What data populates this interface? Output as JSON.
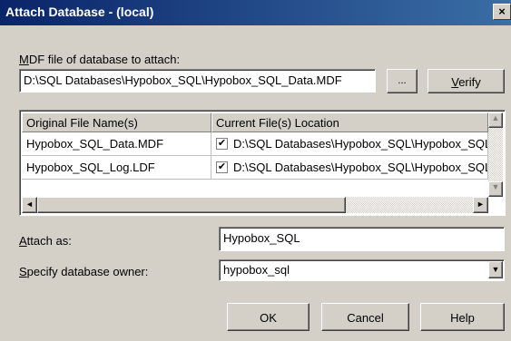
{
  "window": {
    "title": "Attach Database - (local)",
    "close_glyph": "×"
  },
  "mdf": {
    "label_prefix": "M",
    "label_rest": "DF file of database to attach:",
    "value": "D:\\SQL Databases\\Hypobox_SQL\\Hypobox_SQL_Data.MDF",
    "browse_label": "...",
    "verify_prefix": "V",
    "verify_rest": "erify"
  },
  "grid": {
    "col1": "Original File Name(s)",
    "col2": "Current File(s) Location",
    "rows": [
      {
        "name": "Hypobox_SQL_Data.MDF",
        "checked": true,
        "location": "D:\\SQL Databases\\Hypobox_SQL\\Hypobox_SQL_Data.MDF"
      },
      {
        "name": "Hypobox_SQL_Log.LDF",
        "checked": true,
        "location": "D:\\SQL Databases\\Hypobox_SQL\\Hypobox_SQL_Log.LDF"
      }
    ]
  },
  "attach_as": {
    "label_prefix": "A",
    "label_rest": "ttach as:",
    "value": "Hypobox_SQL"
  },
  "owner": {
    "label_prefix": "S",
    "label_rest": "pecify database owner:",
    "value": "hypobox_sql"
  },
  "buttons": {
    "ok": "OK",
    "cancel": "Cancel",
    "help": "Help"
  },
  "icons": {
    "check": "✔",
    "up": "▲",
    "down": "▼",
    "left": "◄",
    "right": "►"
  }
}
